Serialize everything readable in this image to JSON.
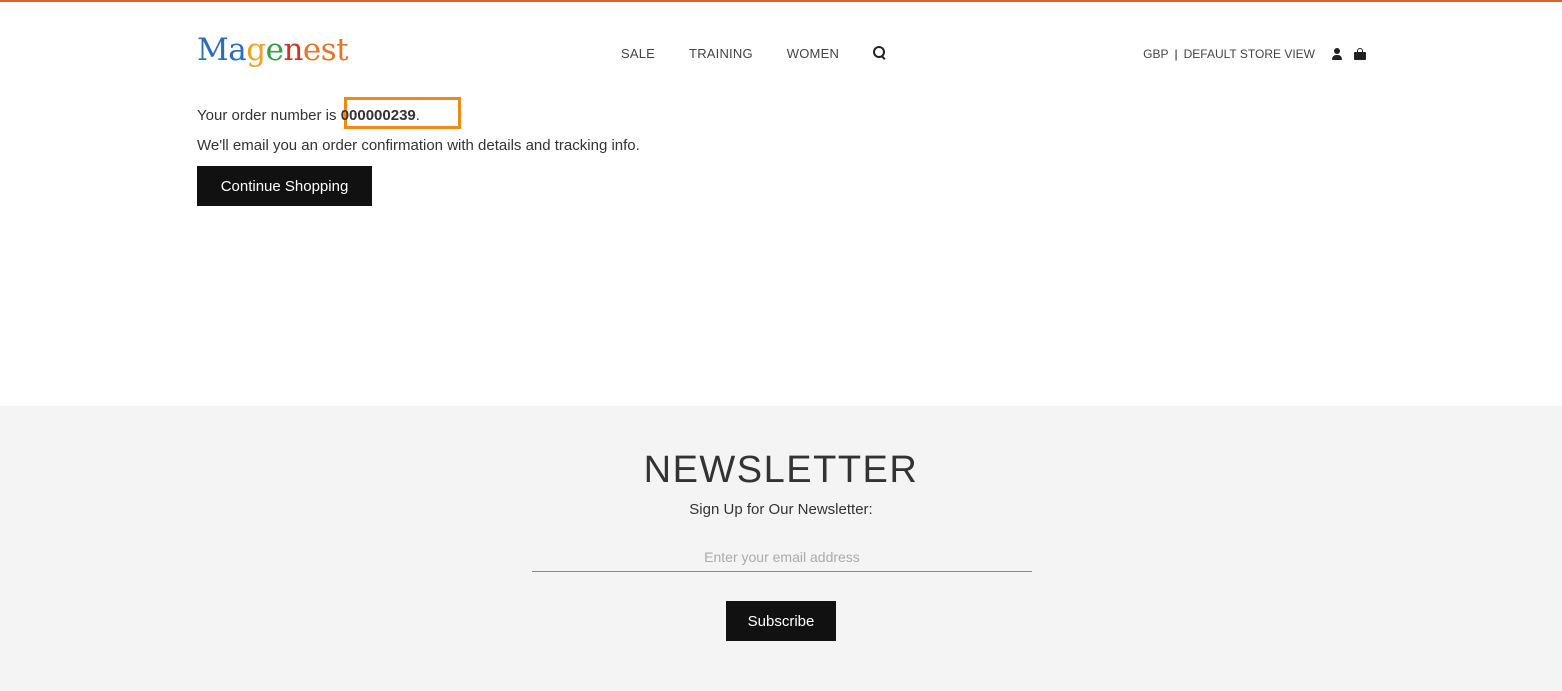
{
  "brand": {
    "logo_parts": [
      "Ma",
      "g",
      "e",
      "n",
      "est"
    ],
    "colors": {
      "accent_border": "#e0622a",
      "highlight": "#f08a10",
      "button_bg": "#111111",
      "footer_bg": "#f4f4f4"
    }
  },
  "nav": {
    "items": [
      {
        "label": "SALE"
      },
      {
        "label": "TRAINING"
      },
      {
        "label": "WOMEN"
      }
    ],
    "search_icon": "search-icon"
  },
  "header_right": {
    "currency": "GBP",
    "separator": "|",
    "store_view": "DEFAULT STORE VIEW",
    "account_icon": "user-icon",
    "cart_icon": "shopping-bag-icon"
  },
  "main": {
    "order_prefix": "Your order number is ",
    "order_number": "000000239",
    "order_suffix": ".",
    "email_text": "We'll email you an order confirmation with details and tracking info.",
    "continue_label": "Continue Shopping"
  },
  "newsletter": {
    "title": "NEWSLETTER",
    "subtitle": "Sign Up for Our Newsletter:",
    "input_placeholder": "Enter your email address",
    "input_value": "",
    "subscribe_label": "Subscribe"
  }
}
